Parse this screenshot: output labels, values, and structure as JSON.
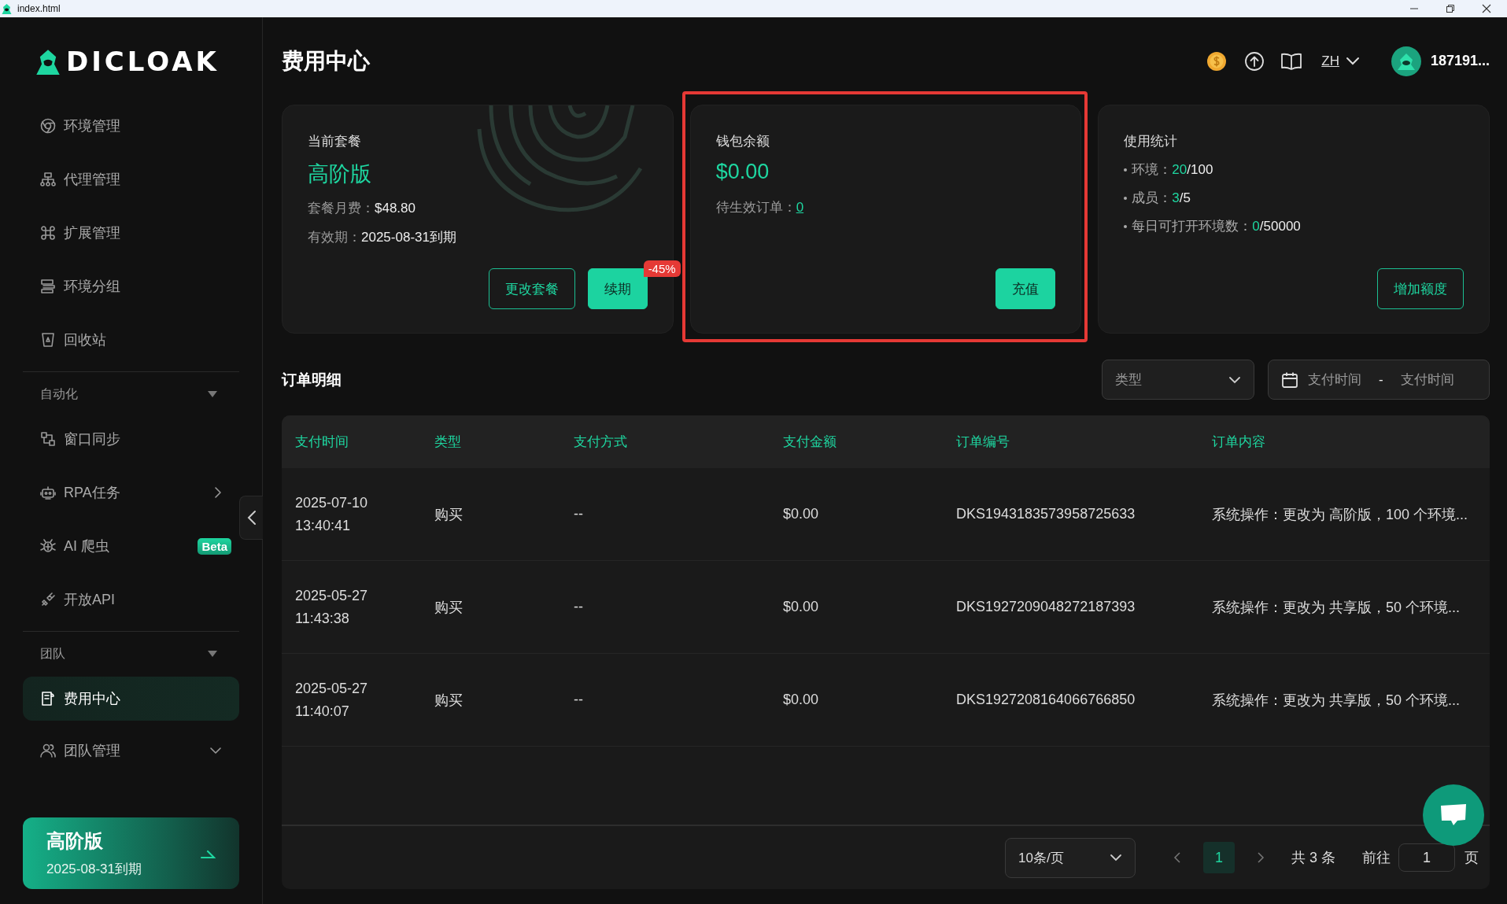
{
  "window": {
    "title": "index.html"
  },
  "sidebar": {
    "logo": "DICLOAK",
    "groups": [
      {
        "items": [
          {
            "kind": "link",
            "label": "环境管理",
            "selected": false
          },
          {
            "kind": "link",
            "label": "代理管理",
            "selected": false
          },
          {
            "kind": "link",
            "label": "扩展管理",
            "selected": false
          },
          {
            "kind": "link",
            "label": "环境分组",
            "selected": false
          },
          {
            "kind": "link",
            "label": "回收站",
            "selected": false
          }
        ]
      },
      {
        "header": "自动化",
        "expanded": true,
        "items": [
          {
            "kind": "link",
            "label": "窗口同步",
            "selected": false
          },
          {
            "kind": "flyout",
            "label": "RPA任务",
            "selected": false
          },
          {
            "kind": "link",
            "label": "AI 爬虫",
            "badge": "Beta",
            "selected": false
          },
          {
            "kind": "link",
            "label": "开放API",
            "selected": false
          }
        ]
      },
      {
        "header": "团队",
        "expanded": true,
        "items": [
          {
            "kind": "link",
            "label": "费用中心",
            "selected": true
          },
          {
            "kind": "submenu",
            "label": "团队管理",
            "expanded": false,
            "selected": false
          }
        ]
      }
    ],
    "plan_card": {
      "plan": "高阶版",
      "expiry": "2025-08-31到期"
    }
  },
  "header": {
    "title": "费用中心",
    "language": "ZH",
    "user": "187191..."
  },
  "cards": {
    "plan": {
      "title": "当前套餐",
      "name": "高阶版",
      "lines": [
        {
          "label": "套餐月费：",
          "value": "$48.80"
        },
        {
          "label": "有效期：",
          "value": "2025-08-31到期"
        }
      ],
      "buttons": [
        {
          "kind": "outline",
          "label": "更改套餐"
        },
        {
          "kind": "solid",
          "label": "续期",
          "badge": "-45%"
        }
      ]
    },
    "wallet": {
      "title": "钱包余额",
      "amount": "$0.00",
      "pending_label": "待生效订单：",
      "pending_value": "0",
      "button": "充值",
      "highlighted": true
    },
    "usage": {
      "title": "使用统计",
      "stats": [
        {
          "label": "环境：",
          "used": "20",
          "total": "/100"
        },
        {
          "label": "成员：",
          "used": "3",
          "total": "/5"
        },
        {
          "label": "每日可打开环境数：",
          "used": "0",
          "total": "/50000"
        }
      ],
      "button": "增加额度"
    }
  },
  "orders": {
    "title": "订单明细",
    "type_filter": {
      "placeholder": "类型"
    },
    "date_filter": {
      "start_placeholder": "支付时间",
      "separator": "-",
      "end_placeholder": "支付时间"
    },
    "columns": [
      "支付时间",
      "类型",
      "支付方式",
      "支付金额",
      "订单编号",
      "订单内容"
    ],
    "rows": [
      [
        "2025-07-10 13:40:41",
        "购买",
        "--",
        "$0.00",
        "DKS1943183573958725633",
        "系统操作：更改为 高阶版，100 个环境..."
      ],
      [
        "2025-05-27 11:43:38",
        "购买",
        "--",
        "$0.00",
        "DKS1927209048272187393",
        "系统操作：更改为 共享版，50 个环境..."
      ],
      [
        "2025-05-27 11:40:07",
        "购买",
        "--",
        "$0.00",
        "DKS1927208164066766850",
        "系统操作：更改为 共享版，50 个环境..."
      ]
    ],
    "pagination": {
      "page_size": "10条/页",
      "pages": [
        {
          "label": "1",
          "selected": true
        }
      ],
      "total": "共 3 条",
      "goto_label": "前往",
      "goto_value": "1",
      "suffix": "页"
    }
  }
}
